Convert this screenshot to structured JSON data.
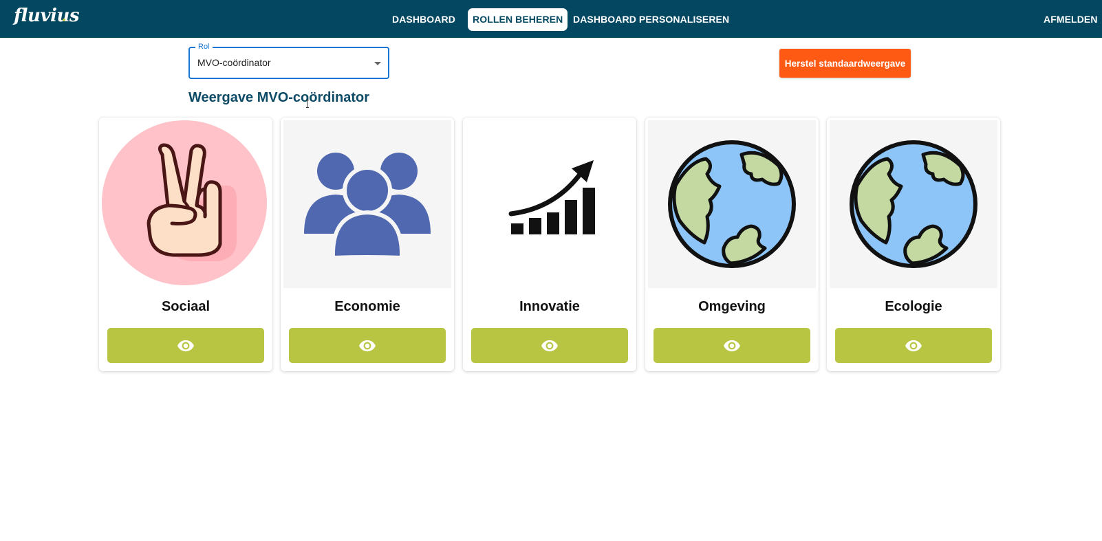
{
  "header": {
    "logo_text": "fluvius",
    "nav": [
      {
        "label": "DASHBOARD",
        "active": false
      },
      {
        "label": "ROLLEN BEHEREN",
        "active": true
      },
      {
        "label": "DASHBOARD PERSONALISEREN",
        "active": false
      }
    ],
    "logout_label": "AFMELDEN"
  },
  "role_select": {
    "label": "Rol",
    "value": "MVO-coördinator"
  },
  "reset_button": {
    "label": "Herstel standaardweergave"
  },
  "page": {
    "heading": "Weergave MVO-coördinator"
  },
  "cards": [
    {
      "title": "Sociaal",
      "icon": "peace-hand-icon",
      "view_icon": "eye-icon"
    },
    {
      "title": "Economie",
      "icon": "people-group-icon",
      "view_icon": "eye-icon"
    },
    {
      "title": "Innovatie",
      "icon": "growth-chart-icon",
      "view_icon": "eye-icon"
    },
    {
      "title": "Omgeving",
      "icon": "globe-icon",
      "view_icon": "eye-icon"
    },
    {
      "title": "Ecologie",
      "icon": "globe-icon",
      "view_icon": "eye-icon"
    }
  ],
  "colors": {
    "topbar": "#034761",
    "accent_orange": "#ff5a14",
    "button_green": "#b7c542",
    "heading_blue": "#0c4a66",
    "select_border": "#1976d2"
  }
}
